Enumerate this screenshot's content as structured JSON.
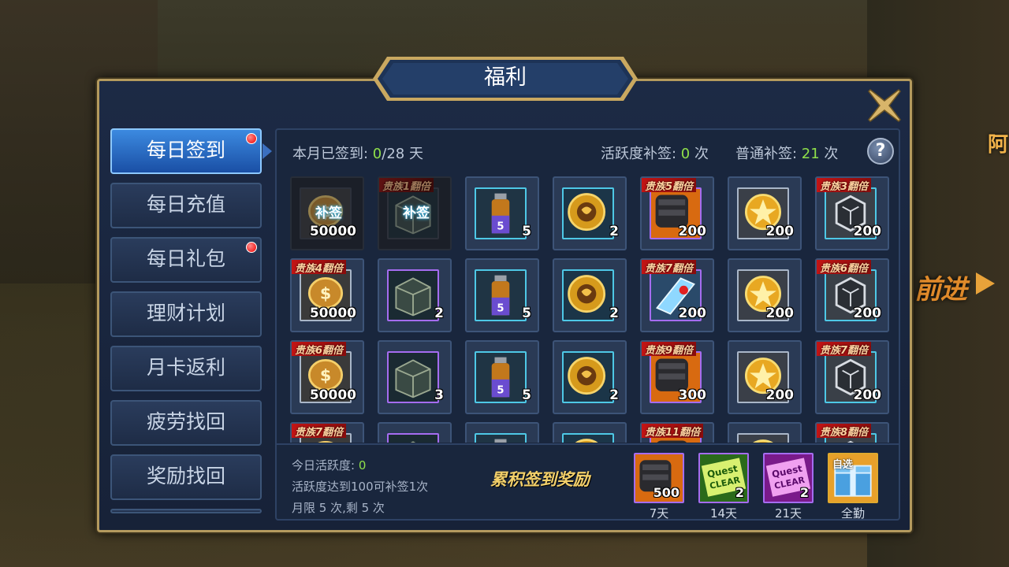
{
  "window": {
    "title": "福利",
    "close_icon": "close-x-icon"
  },
  "background": {
    "text_top": "阿",
    "text_banner": "前进"
  },
  "sidebar": {
    "items": [
      {
        "label": "每日签到",
        "active": true,
        "red_dot": true
      },
      {
        "label": "每日充值",
        "active": false,
        "red_dot": false
      },
      {
        "label": "每日礼包",
        "active": false,
        "red_dot": true
      },
      {
        "label": "理财计划",
        "active": false,
        "red_dot": false
      },
      {
        "label": "月卡返利",
        "active": false,
        "red_dot": false
      },
      {
        "label": "疲劳找回",
        "active": false,
        "red_dot": false
      },
      {
        "label": "奖励找回",
        "active": false,
        "red_dot": false
      }
    ]
  },
  "header": {
    "signed_prefix": "本月已签到: ",
    "signed_value": "0",
    "signed_suffix": "/28 天",
    "active_prefix": "活跃度补签: ",
    "active_value": "0",
    "active_suffix": " 次",
    "normal_prefix": "普通补签: ",
    "normal_value": "21",
    "normal_suffix": " 次",
    "help_label": "?"
  },
  "days": [
    {
      "item": "gold-coin",
      "qty": "50000",
      "frame": "k",
      "makeup": "补签",
      "tag": "",
      "signed": true
    },
    {
      "item": "treasure-box",
      "qty": "",
      "frame": "k",
      "makeup": "补签",
      "tag": "贵族1翻倍",
      "signed": true,
      "tag_dim": true
    },
    {
      "item": "potion",
      "qty": "5",
      "frame": "c",
      "makeup": "",
      "tag": ""
    },
    {
      "item": "medal-coin",
      "qty": "2",
      "frame": "c",
      "makeup": "",
      "tag": ""
    },
    {
      "item": "gauntlet",
      "qty": "200",
      "frame": "p",
      "makeup": "",
      "tag": "贵族5翻倍"
    },
    {
      "item": "star-coin",
      "qty": "200",
      "frame": "w",
      "makeup": "",
      "tag": ""
    },
    {
      "item": "rune-cube",
      "qty": "200",
      "frame": "c",
      "makeup": "",
      "tag": "贵族3翻倍"
    },
    {
      "item": "gold-coin",
      "qty": "50000",
      "frame": "w",
      "makeup": "",
      "tag": "贵族4翻倍"
    },
    {
      "item": "treasure-box",
      "qty": "2",
      "frame": "p",
      "makeup": "",
      "tag": ""
    },
    {
      "item": "potion",
      "qty": "5",
      "frame": "c",
      "makeup": "",
      "tag": ""
    },
    {
      "item": "medal-coin",
      "qty": "2",
      "frame": "c",
      "makeup": "",
      "tag": ""
    },
    {
      "item": "ice-weapon",
      "qty": "200",
      "frame": "p",
      "makeup": "",
      "tag": "贵族7翻倍"
    },
    {
      "item": "star-coin",
      "qty": "200",
      "frame": "w",
      "makeup": "",
      "tag": ""
    },
    {
      "item": "rune-cube",
      "qty": "200",
      "frame": "c",
      "makeup": "",
      "tag": "贵族6翻倍"
    },
    {
      "item": "gold-coin",
      "qty": "50000",
      "frame": "w",
      "makeup": "",
      "tag": "贵族6翻倍"
    },
    {
      "item": "treasure-box",
      "qty": "3",
      "frame": "p",
      "makeup": "",
      "tag": ""
    },
    {
      "item": "potion",
      "qty": "5",
      "frame": "c",
      "makeup": "",
      "tag": ""
    },
    {
      "item": "medal-coin",
      "qty": "2",
      "frame": "c",
      "makeup": "",
      "tag": ""
    },
    {
      "item": "gauntlet",
      "qty": "300",
      "frame": "p",
      "makeup": "",
      "tag": "贵族9翻倍"
    },
    {
      "item": "star-coin",
      "qty": "200",
      "frame": "w",
      "makeup": "",
      "tag": ""
    },
    {
      "item": "rune-cube",
      "qty": "200",
      "frame": "c",
      "makeup": "",
      "tag": "贵族7翻倍"
    },
    {
      "item": "gold-coin",
      "qty": "",
      "frame": "w",
      "makeup": "",
      "tag": "贵族7翻倍"
    },
    {
      "item": "treasure-box",
      "qty": "",
      "frame": "p",
      "makeup": "",
      "tag": ""
    },
    {
      "item": "potion",
      "qty": "",
      "frame": "c",
      "makeup": "",
      "tag": ""
    },
    {
      "item": "medal-coin",
      "qty": "",
      "frame": "c",
      "makeup": "",
      "tag": ""
    },
    {
      "item": "gauntlet",
      "qty": "",
      "frame": "p",
      "makeup": "",
      "tag": "贵族11翻倍"
    },
    {
      "item": "star-coin",
      "qty": "",
      "frame": "w",
      "makeup": "",
      "tag": ""
    },
    {
      "item": "rune-cube",
      "qty": "",
      "frame": "c",
      "makeup": "",
      "tag": "贵族8翻倍"
    }
  ],
  "footer": {
    "activity_prefix": "今日活跃度: ",
    "activity_value": "0",
    "rule1": "活跃度达到100可补签1次",
    "rule2": "月限 5 次,剩 5 次",
    "accum_title": "累积签到奖励",
    "rewards": [
      {
        "item": "gauntlet",
        "qty": "500",
        "label": "7天",
        "pick": ""
      },
      {
        "item": "quest-clear-green",
        "qty": "2",
        "label": "14天",
        "pick": ""
      },
      {
        "item": "quest-clear-purple",
        "qty": "2",
        "label": "21天",
        "pick": ""
      },
      {
        "item": "gift-chest",
        "qty": "",
        "label": "全勤",
        "pick": "自选"
      }
    ]
  }
}
